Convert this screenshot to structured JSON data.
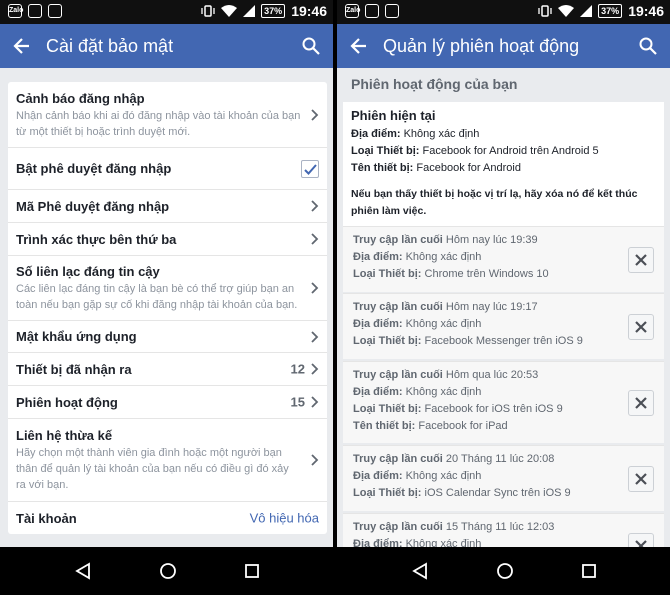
{
  "status": {
    "battery": "37%",
    "time": "19:46",
    "app_icon_label": "Zalo"
  },
  "left": {
    "title": "Cài đặt bảo mật",
    "rows": [
      {
        "label": "Cảnh báo đăng nhập",
        "desc": "Nhận cảnh báo khi ai đó đăng nhập vào tài khoản của bạn từ một thiết bị hoặc trình duyệt mới."
      },
      {
        "label": "Bật phê duyệt đăng nhập",
        "checked": true
      },
      {
        "label": "Mã Phê duyệt đăng nhập"
      },
      {
        "label": "Trình xác thực bên thứ ba"
      },
      {
        "label": "Số liên lạc đáng tin cậy",
        "desc": "Các liên lạc đáng tin cậy là bạn bè có thể trợ giúp bạn an toàn nếu bạn gặp sự cố khi đăng nhập tài khoản của bạn."
      },
      {
        "label": "Mật khẩu ứng dụng"
      },
      {
        "label": "Thiết bị đã nhận ra",
        "count": "12"
      },
      {
        "label": "Phiên hoạt động",
        "count": "15"
      },
      {
        "label": "Liên hệ thừa kế",
        "desc": "Hãy chọn một thành viên gia đình hoặc một người bạn thân để quản lý tài khoản của bạn nếu có điều gì đó xảy ra với bạn."
      },
      {
        "label": "Tài khoản",
        "action": "Vô hiệu hóa"
      }
    ]
  },
  "right": {
    "title": "Quản lý phiên hoạt động",
    "section_title": "Phiên hoạt động của bạn",
    "labels": {
      "last_access": "Truy cập lần cuối",
      "location": "Địa điểm:",
      "device_type": "Loại Thiết bị:",
      "device_name": "Tên thiết bị:"
    },
    "current": {
      "title": "Phiên hiện tại",
      "location": "Không xác định",
      "device_type": "Facebook for Android trên Android 5",
      "device_name": "Facebook for Android"
    },
    "notice": "Nếu bạn thấy thiết bị hoặc vị trí lạ, hãy xóa nó để kết thúc phiên làm việc.",
    "sessions": [
      {
        "last_access": "Hôm nay lúc 19:39",
        "location": "Không xác định",
        "device_type": "Chrome trên Windows 10"
      },
      {
        "last_access": "Hôm nay lúc 19:17",
        "location": "Không xác định",
        "device_type": "Facebook Messenger trên iOS 9"
      },
      {
        "last_access": "Hôm qua lúc 20:53",
        "location": "Không xác định",
        "device_type": "Facebook for iOS trên iOS 9",
        "device_name": "Facebook for iPad"
      },
      {
        "last_access": "20 Tháng 11 lúc 20:08",
        "location": "Không xác định",
        "device_type": "iOS Calendar Sync trên iOS 9"
      },
      {
        "last_access": "15 Tháng 11 lúc 12:03",
        "location": "Không xác định"
      }
    ]
  },
  "colors": {
    "brand": "#4267b2",
    "background": "#e9ebee"
  }
}
